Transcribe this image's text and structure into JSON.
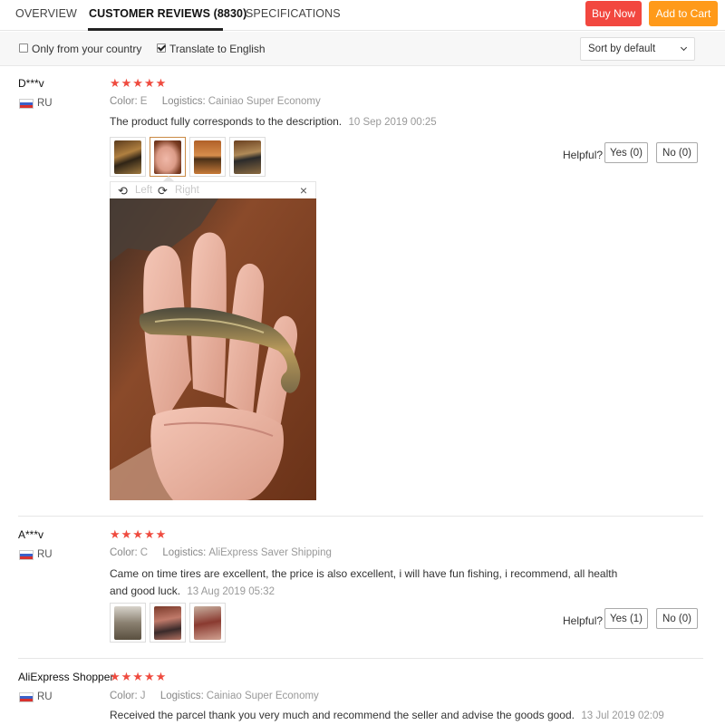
{
  "tabs": [
    {
      "label": "OVERVIEW",
      "active": false
    },
    {
      "label": "CUSTOMER REVIEWS (8830)",
      "active": true
    },
    {
      "label": "SPECIFICATIONS",
      "active": false
    }
  ],
  "actions": {
    "buy_now": "Buy Now",
    "add_to_cart": "Add to Cart",
    "buy_color": "#f2473f",
    "cart_color": "#ff9a1a"
  },
  "filters": {
    "only_country": {
      "label": "Only from your country",
      "checked": false
    },
    "translate": {
      "label": "Translate to English",
      "checked": true
    },
    "sort": "Sort by default"
  },
  "rating_color": "#ef4b3f",
  "reviews": [
    {
      "reviewer": "D***v",
      "country": "RU",
      "stars": "★★★★★",
      "color_label": "Color:",
      "color_value": "E",
      "logistics_label": "Logistics:",
      "logistics_value": "Cainiao Super Economy",
      "text": "The product fully corresponds to the description.",
      "date": "10 Sep 2019 00:25",
      "helpful_label": "Helpful?",
      "yes": "Yes (0)",
      "no": "No (0)",
      "viewer": {
        "left": "Left",
        "right": "Right",
        "close": "×"
      }
    },
    {
      "reviewer": "A***v",
      "country": "RU",
      "stars": "★★★★★",
      "color_label": "Color:",
      "color_value": "C",
      "logistics_label": "Logistics:",
      "logistics_value": "AliExpress Saver Shipping",
      "text": "Came on time tires are excellent, the price is also excellent, i will have fun fishing, i recommend, all health and good luck.",
      "date": "13 Aug 2019 05:32",
      "helpful_label": "Helpful?",
      "yes": "Yes (1)",
      "no": "No (0)"
    },
    {
      "reviewer": "AliExpress Shopper",
      "country": "RU",
      "stars": "★★★★★",
      "color_label": "Color:",
      "color_value": "J",
      "logistics_label": "Logistics:",
      "logistics_value": "Cainiao Super Economy",
      "text": "Received the parcel thank you very much and recommend the seller and advise the goods good.",
      "date": "13 Jul 2019 02:09"
    }
  ]
}
